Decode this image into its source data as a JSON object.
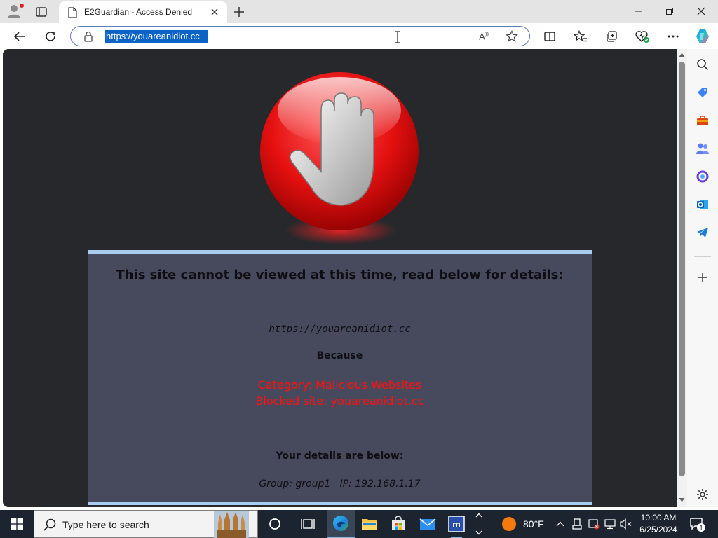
{
  "browser": {
    "tab": {
      "title": "E2Guardian - Access Denied"
    },
    "address_bar": {
      "url": "https://youareanidiot.cc"
    },
    "read_aloud_label": "A",
    "colors": {
      "url_highlight": "#0b64c5",
      "tab_bg": "#e4e4e4"
    }
  },
  "page": {
    "heading": "This site cannot be viewed at this time, read below for details:",
    "blocked_url": "https://youareanidiot.cc",
    "because_label": "Because",
    "category": "Category: Malicious Websites",
    "blocked_site": "Blocked site: youareanidiot.cc",
    "details_heading": "Your details are below:",
    "group_ip": "Group: group1   IP: 192.168.1.17",
    "colors": {
      "background": "#26282c",
      "panel": "#474a5c",
      "panel_border": "#a8cdf0",
      "reason_text": "#ff1010"
    }
  },
  "sidebar": {
    "items": [
      "search-icon",
      "tag-icon",
      "toolbox-icon",
      "people-icon",
      "copilot-icon",
      "outlook-icon",
      "telegram-icon",
      "add-icon",
      "settings-icon"
    ]
  },
  "taskbar": {
    "search_placeholder": "Type here to search",
    "weather": {
      "temp": "80°F"
    },
    "clock": {
      "time": "10:00 AM",
      "date": "6/25/2024"
    },
    "notification_count": "1",
    "pinned": [
      "task-view-icon",
      "cortana-icon",
      "edge-icon",
      "file-explorer-icon",
      "store-icon",
      "mail-icon",
      "app-m-icon"
    ]
  }
}
